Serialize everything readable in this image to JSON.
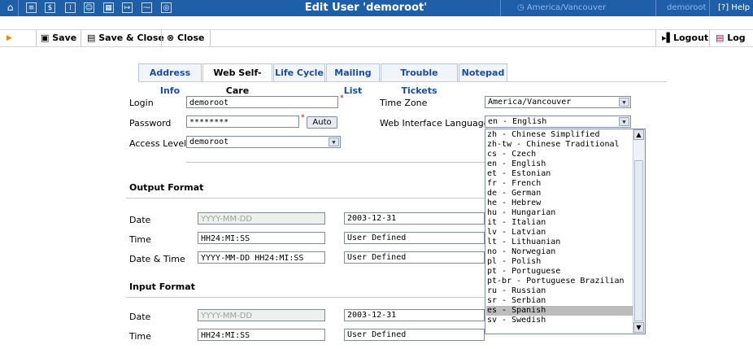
{
  "window": {
    "title": "Edit User 'demoroot'",
    "timezone": "America/Vancouver",
    "user": "demoroot",
    "help": "Help"
  },
  "toolbar": {
    "save": "Save",
    "save_close": "Save & Close",
    "close": "Close",
    "logout": "Logout",
    "log": "Log"
  },
  "tabs": [
    "Address Info",
    "Web Self-Care",
    "Life Cycle",
    "Mailing List",
    "Trouble Tickets",
    "Notepad"
  ],
  "form": {
    "login_label": "Login",
    "login_value": "demoroot",
    "password_label": "Password",
    "password_value": "********",
    "auto_label": "Auto",
    "access_label": "Access Level",
    "access_value": "demoroot",
    "tz_label": "Time Zone",
    "tz_value": "America/Vancouver",
    "lang_label": "Web Interface Language",
    "lang_value": "en - English"
  },
  "output_format": {
    "heading": "Output Format",
    "date_label": "Date",
    "date_value": "YYYY-MM-DD",
    "date_select": "2003-12-31",
    "time_label": "Time",
    "time_value": "HH24:MI:SS",
    "time_select": "User Defined",
    "datetime_label": "Date & Time",
    "datetime_value": "YYYY-MM-DD HH24:MI:SS",
    "datetime_select": "User Defined"
  },
  "input_format": {
    "heading": "Input Format",
    "date_label": "Date",
    "date_value": "YYYY-MM-DD",
    "date_select": "2003-12-31",
    "time_label": "Time",
    "time_value": "HH24:MI:SS",
    "time_select": "User Defined"
  },
  "languages": [
    "zh - Chinese Simplified",
    "zh-tw - Chinese Traditional",
    "cs - Czech",
    "en - English",
    "et - Estonian",
    "fr - French",
    "de - German",
    "he - Hebrew",
    "hu - Hungarian",
    "it - Italian",
    "lv - Latvian",
    "lt - Lithuanian",
    "no - Norwegian",
    "pl - Polish",
    "pt - Portuguese",
    "pt-br - Portuguese Brazilian",
    "ru - Russian",
    "sr - Serbian",
    "es - Spanish",
    "sv - Swedish"
  ],
  "highlighted_language": "es - Spanish",
  "colors": {
    "topbar": "#1f5fa8",
    "tab_text": "#1a4ca0",
    "highlight": "#bcbcbc"
  }
}
